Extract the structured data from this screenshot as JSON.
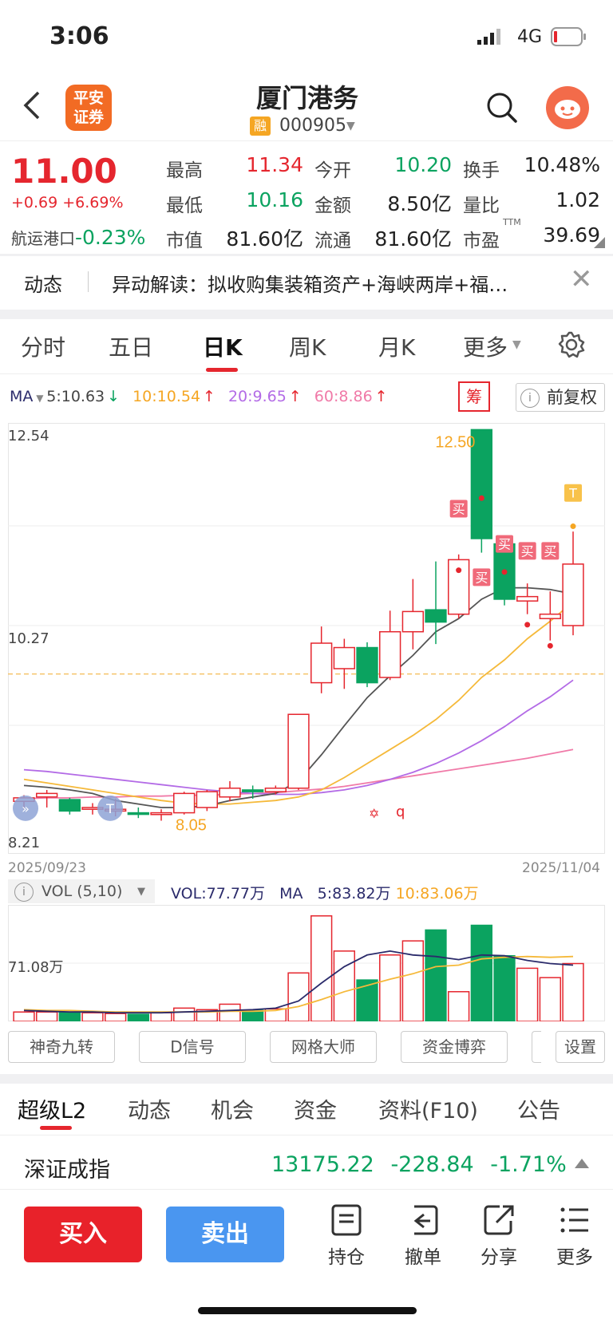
{
  "status": {
    "time": "3:06",
    "network": "4G"
  },
  "header": {
    "logo_line1": "平安",
    "logo_line2": "证券",
    "name": "厦门港务",
    "rong_badge": "融",
    "code": "000905"
  },
  "quote": {
    "price": "11.00",
    "change": "+0.69 +6.69%",
    "sector_name": "航运港口",
    "sector_change": "-0.23%",
    "fields": [
      {
        "label": "最高",
        "value": "11.34",
        "tone": "red"
      },
      {
        "label": "今开",
        "value": "10.20",
        "tone": "green"
      },
      {
        "label": "换手",
        "value": "10.48%",
        "tone": "black"
      },
      {
        "label": "最低",
        "value": "10.16",
        "tone": "green"
      },
      {
        "label": "金额",
        "value": "8.50亿",
        "tone": "black"
      },
      {
        "label": "量比",
        "value": "1.02",
        "tone": "black"
      },
      {
        "label": "市值",
        "value": "81.60亿",
        "tone": "black"
      },
      {
        "label": "流通",
        "value": "81.60亿",
        "tone": "black"
      },
      {
        "label": "市盈",
        "value": "39.69",
        "tone": "black",
        "sup": "TTM"
      }
    ]
  },
  "news": {
    "tag": "动态",
    "text": "异动解读：拟收购集装箱资产+海峡两岸+福…"
  },
  "period_tabs": [
    "分时",
    "五日",
    "日K",
    "周K",
    "月K",
    "更多"
  ],
  "ma": {
    "label": "MA",
    "items": [
      {
        "text": "5:10.63",
        "color": "#444444",
        "arrow": "↓",
        "arrow_color": "#0ba360"
      },
      {
        "text": "10:10.54",
        "color": "#f5a623",
        "arrow": "↑",
        "arrow_color": "#e5262e"
      },
      {
        "text": "20:9.65",
        "color": "#b36be6",
        "arrow": "↑",
        "arrow_color": "#e5262e"
      },
      {
        "text": "60:8.86",
        "color": "#f07aa8",
        "arrow": "↑",
        "arrow_color": "#e5262e"
      }
    ],
    "chou": "筹",
    "fq": "前复权"
  },
  "chart_data": {
    "type": "candlestick",
    "ylim": [
      8.0,
      12.54
    ],
    "axis_labels": {
      "top": "12.54",
      "mid": "10.27",
      "low": "8.21"
    },
    "max_label": "12.50",
    "min_label": "8.05",
    "date_start": "2025/09/23",
    "date_end": "2025/11/04",
    "dashed_level": 9.72,
    "candles": [
      {
        "o": 8.27,
        "c": 8.31,
        "h": 8.34,
        "l": 8.18
      },
      {
        "o": 8.32,
        "c": 8.36,
        "h": 8.4,
        "l": 8.2
      },
      {
        "o": 8.29,
        "c": 8.16,
        "h": 8.31,
        "l": 8.12
      },
      {
        "o": 8.18,
        "c": 8.2,
        "h": 8.25,
        "l": 8.12
      },
      {
        "o": 8.16,
        "c": 8.18,
        "h": 8.3,
        "l": 8.1
      },
      {
        "o": 8.14,
        "c": 8.13,
        "h": 8.2,
        "l": 8.08
      },
      {
        "o": 8.12,
        "c": 8.14,
        "h": 8.18,
        "l": 8.05
      },
      {
        "o": 8.14,
        "c": 8.36,
        "h": 8.38,
        "l": 8.12
      },
      {
        "o": 8.2,
        "c": 8.38,
        "h": 8.4,
        "l": 8.16
      },
      {
        "o": 8.32,
        "c": 8.42,
        "h": 8.5,
        "l": 8.27
      },
      {
        "o": 8.4,
        "c": 8.38,
        "h": 8.45,
        "l": 8.3
      },
      {
        "o": 8.38,
        "c": 8.42,
        "h": 8.45,
        "l": 8.35
      },
      {
        "o": 8.42,
        "c": 9.26,
        "h": 9.26,
        "l": 8.4
      },
      {
        "o": 9.62,
        "c": 10.07,
        "h": 10.26,
        "l": 9.5
      },
      {
        "o": 9.78,
        "c": 10.02,
        "h": 10.12,
        "l": 9.55
      },
      {
        "o": 10.02,
        "c": 9.62,
        "h": 10.08,
        "l": 9.57
      },
      {
        "o": 9.68,
        "c": 10.2,
        "h": 10.44,
        "l": 9.65
      },
      {
        "o": 10.2,
        "c": 10.43,
        "h": 10.8,
        "l": 10.0
      },
      {
        "o": 10.45,
        "c": 10.31,
        "h": 11.0,
        "l": 10.06
      },
      {
        "o": 10.4,
        "c": 11.02,
        "h": 11.08,
        "l": 10.35
      },
      {
        "o": 12.5,
        "c": 11.26,
        "h": 12.5,
        "l": 11.1
      },
      {
        "o": 11.2,
        "c": 10.57,
        "h": 11.28,
        "l": 10.5
      },
      {
        "o": 10.55,
        "c": 10.6,
        "h": 10.75,
        "l": 10.4
      },
      {
        "o": 10.35,
        "c": 10.4,
        "h": 10.66,
        "l": 10.1
      },
      {
        "o": 10.27,
        "c": 10.97,
        "h": 11.34,
        "l": 10.16
      }
    ],
    "ma5": [
      8.45,
      8.43,
      8.4,
      8.36,
      8.28,
      8.24,
      8.2,
      8.2,
      8.22,
      8.28,
      8.32,
      8.36,
      8.5,
      8.8,
      9.13,
      9.45,
      9.7,
      9.93,
      10.2,
      10.35,
      10.57,
      10.7,
      10.7,
      10.68,
      10.63
    ],
    "ma10": [
      8.52,
      8.48,
      8.44,
      8.4,
      8.36,
      8.32,
      8.28,
      8.25,
      8.24,
      8.24,
      8.26,
      8.28,
      8.32,
      8.4,
      8.54,
      8.7,
      8.86,
      9.02,
      9.2,
      9.42,
      9.68,
      9.88,
      10.12,
      10.32,
      10.54
    ],
    "ma20": [
      8.63,
      8.61,
      8.58,
      8.55,
      8.52,
      8.49,
      8.46,
      8.43,
      8.4,
      8.38,
      8.36,
      8.35,
      8.35,
      8.37,
      8.4,
      8.45,
      8.52,
      8.6,
      8.7,
      8.82,
      8.96,
      9.12,
      9.3,
      9.46,
      9.65
    ],
    "ma60": [
      8.3,
      8.31,
      8.31,
      8.32,
      8.32,
      8.33,
      8.33,
      8.34,
      8.34,
      8.35,
      8.36,
      8.37,
      8.39,
      8.41,
      8.44,
      8.48,
      8.52,
      8.56,
      8.6,
      8.64,
      8.68,
      8.72,
      8.76,
      8.81,
      8.86
    ],
    "signals": [
      {
        "idx": 19,
        "text": "买",
        "level": 11.6
      },
      {
        "idx": 20,
        "text": "买",
        "level": 10.82
      },
      {
        "idx": 21,
        "text": "买",
        "level": 11.2
      },
      {
        "idx": 22,
        "text": "买",
        "level": 11.12
      },
      {
        "idx": 23,
        "text": "买",
        "level": 11.12
      },
      {
        "idx": 24,
        "text": "T",
        "level": 11.78
      }
    ],
    "volume": {
      "values": [
        12,
        12,
        12,
        11,
        10,
        9,
        11,
        17,
        15,
        22,
        14,
        16,
        62,
        135,
        90,
        53,
        85,
        103,
        117,
        38,
        123,
        84,
        68,
        56,
        74
      ],
      "ma5": [
        14,
        13,
        12,
        12,
        11,
        11,
        11,
        12,
        13,
        14,
        15,
        17,
        26,
        49,
        70,
        85,
        90,
        85,
        83,
        79,
        85,
        84,
        78,
        74,
        72
      ],
      "ma10": [
        15,
        14,
        14,
        13,
        12,
        12,
        12,
        12,
        12,
        13,
        13,
        14,
        19,
        28,
        38,
        46,
        54,
        61,
        70,
        72,
        80,
        82,
        83,
        82,
        83
      ],
      "axis_label": "71.08万"
    }
  },
  "vol": {
    "label": "VOL (5,10)",
    "vol_text": "VOL:77.77万",
    "ma_text": "MA",
    "ma5_text": "5:83.82万",
    "ma10_text": "10:83.06万"
  },
  "indicators": [
    "神奇九转",
    "D信号",
    "网格大师",
    "资金博弈",
    "设置"
  ],
  "bottom_tabs": [
    "超级L2",
    "动态",
    "机会",
    "资金",
    "资料(F10)",
    "公告"
  ],
  "index": {
    "name": "深证成指",
    "value": "13175.22",
    "change": "-228.84",
    "pct": "-1.71%"
  },
  "toolbar": {
    "buy": "买入",
    "sell": "卖出",
    "hold": "持仓",
    "cancel": "撤单",
    "share": "分享",
    "more": "更多"
  }
}
